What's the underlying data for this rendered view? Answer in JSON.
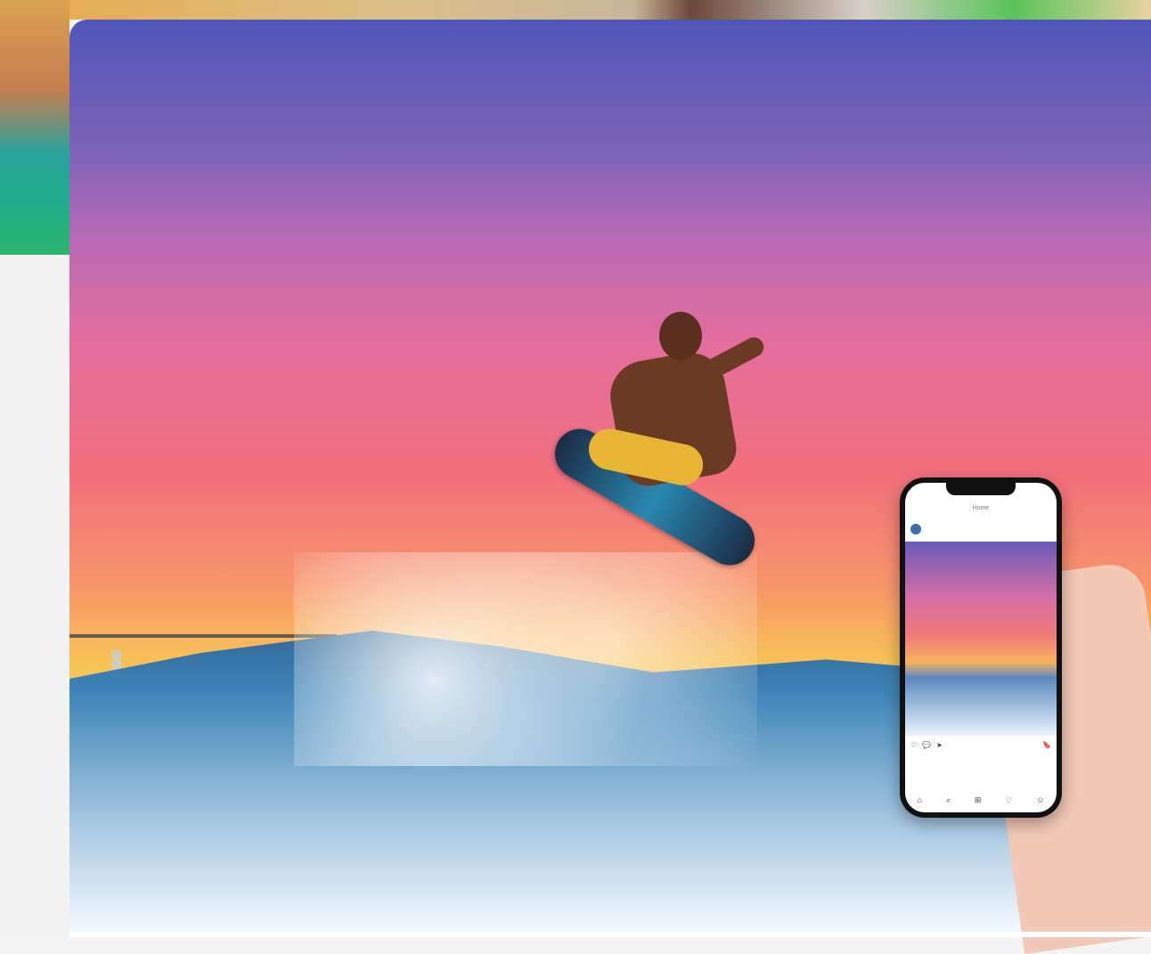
{
  "scene": {
    "photo_alt": "",
    "phone_app": {
      "top_bar_label": "Home",
      "username": "",
      "caption": "",
      "nav_icons": [
        "home-icon",
        "search-icon",
        "plus-square-icon",
        "heart-icon",
        "profile-icon"
      ],
      "post_actions_icons": [
        "heart-icon",
        "comment-icon",
        "share-icon",
        "bookmark-icon"
      ]
    }
  },
  "colors": {
    "sky_top": "#4f56b8",
    "sky_mid": "#f2707c",
    "sky_low": "#f7bf58",
    "wave_blue": "#2f5f8f"
  }
}
